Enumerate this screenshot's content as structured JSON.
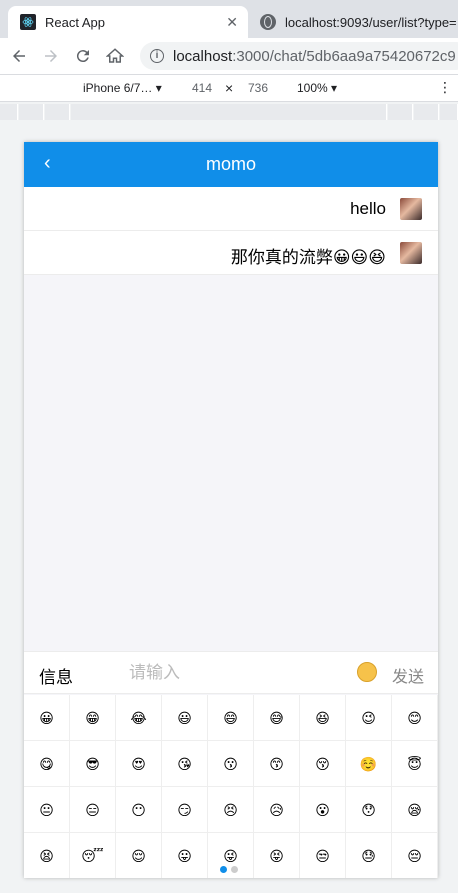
{
  "browser": {
    "tabs": [
      {
        "title": "React App",
        "active": true
      },
      {
        "title": "localhost:9093/user/list?type=",
        "active": false
      }
    ],
    "url_host": "localhost",
    "url_rest": ":3000/chat/5db6aa9a75420672c9",
    "device_toolbar": {
      "device": "iPhone 6/7… ▾",
      "width": "414",
      "times": "×",
      "height": "736",
      "zoom": "100% ▾"
    }
  },
  "app": {
    "navbar": {
      "title": "momo",
      "back": "‹"
    },
    "messages": [
      {
        "text": "hello"
      },
      {
        "text": "那你真的流弊😀😃😆"
      }
    ],
    "input_bar": {
      "label": "信息",
      "placeholder": "请输入",
      "send": "发送"
    },
    "emojis": [
      "😀",
      "😁",
      "😂",
      "😃",
      "😄",
      "😅",
      "😆",
      "😉",
      "😊",
      "😋",
      "😎",
      "😍",
      "😘",
      "😗",
      "😙",
      "😚",
      "☺️",
      "😇",
      "😐",
      "😑",
      "😶",
      "😏",
      "😣",
      "😥",
      "😮",
      "😯",
      "😪",
      "😫",
      "😴",
      "😌",
      "😛",
      "😜",
      "😝",
      "😒",
      "😓",
      "😔"
    ],
    "pager": {
      "count": 2,
      "active": 0
    }
  },
  "colors": {
    "brand": "#108ee9"
  }
}
